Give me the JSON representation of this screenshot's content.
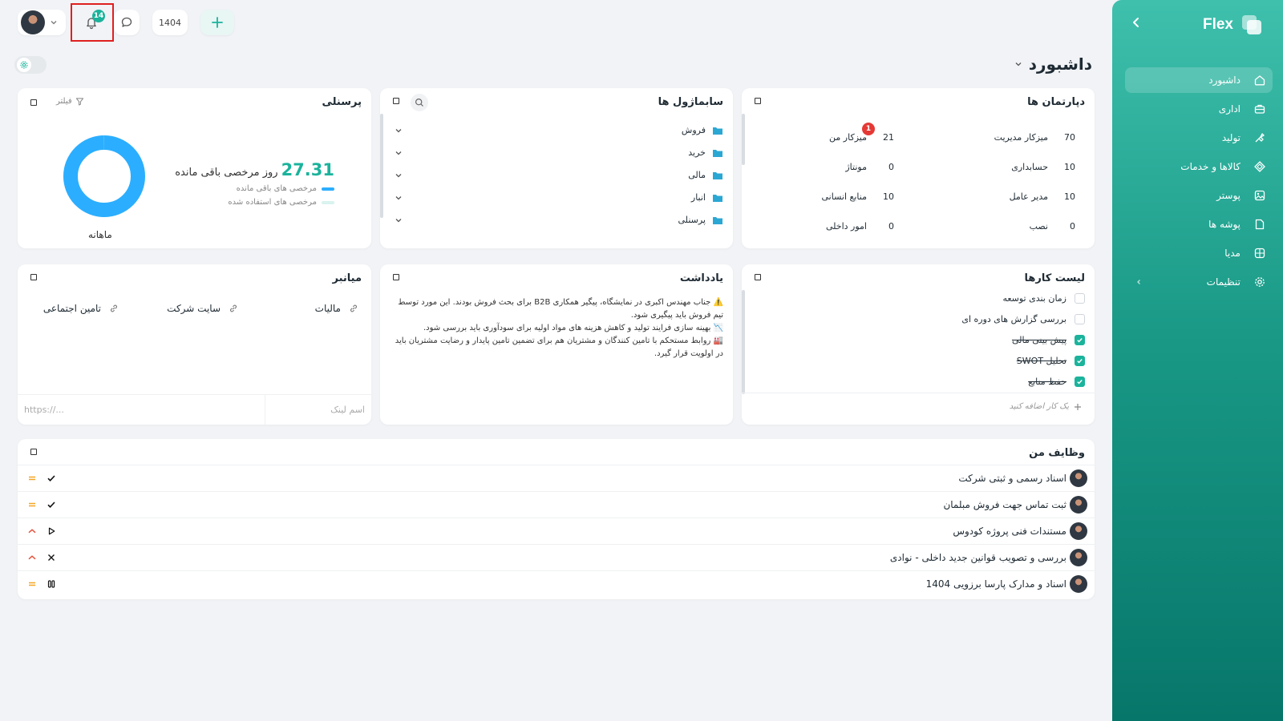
{
  "sidebar": {
    "brand": "Flex",
    "items": [
      {
        "label": "داشبورد",
        "icon": "home-icon"
      },
      {
        "label": "اداری",
        "icon": "briefcase-icon"
      },
      {
        "label": "تولید",
        "icon": "factory-icon"
      },
      {
        "label": "کالاها و خدمات",
        "icon": "box-icon"
      },
      {
        "label": "پوستر",
        "icon": "image-icon"
      },
      {
        "label": "پوشه ها",
        "icon": "folder-icon"
      },
      {
        "label": "مدیا",
        "icon": "globe-icon"
      },
      {
        "label": "تنظیمات",
        "icon": "gear-icon"
      }
    ]
  },
  "topbar": {
    "notification_count": "14",
    "year": "1404"
  },
  "page": {
    "title": "داشبورد"
  },
  "departments": {
    "title": "دپارتمان ها",
    "items": [
      {
        "label": "میزکار مدیریت",
        "count": "70"
      },
      {
        "label": "میزکار من",
        "count": "21",
        "badge": "1"
      },
      {
        "label": "حسابداری",
        "count": "10"
      },
      {
        "label": "مونتاژ",
        "count": "0"
      },
      {
        "label": "مدیر عامل",
        "count": "10"
      },
      {
        "label": "منابع انسانی",
        "count": "10"
      },
      {
        "label": "نصب",
        "count": "0"
      },
      {
        "label": "امور داخلی",
        "count": "0"
      }
    ]
  },
  "org": {
    "title": "سابماژول ها",
    "items": [
      "فروش",
      "خرید",
      "مالی",
      "انبار",
      "پرسنلی"
    ]
  },
  "personnel": {
    "title": "پرسنلی",
    "filter_label": "فیلتر",
    "value": "27.31",
    "value_label": "روز مرخصی باقی مانده",
    "legend_remaining": "مرخصی های باقی مانده",
    "legend_used": "مرخصی های استفاده شده",
    "period": "ماهانه",
    "remaining_fraction": 1.0,
    "colors": {
      "remaining": "#2baeff",
      "used": "#d9f3ef"
    }
  },
  "todo": {
    "title": "لیست کارها",
    "items": [
      {
        "label": "زمان بندی توسعه",
        "done": false
      },
      {
        "label": "بررسی گزارش های دوره ای",
        "done": false
      },
      {
        "label": "پیش بینی مالی",
        "done": true
      },
      {
        "label": "تحلیل SWOT",
        "done": true
      },
      {
        "label": "حفظ منابع",
        "done": true
      }
    ],
    "add_placeholder": "یک کار اضافه کنید"
  },
  "note": {
    "title": "یادداشت",
    "lines": [
      "⚠️ جناب مهندس اکبری در نمایشگاه، پیگیر همکاری B2B برای بحث فروش بودند. این مورد توسط تیم فروش باید پیگیری شود.",
      "📉 بهینه سازی فرایند تولید و کاهش هزینه های مواد اولیه برای سودآوری باید بررسی شود.",
      "🏭 روابط مستحکم با تامین کنندگان و مشتریان هم برای تضمین تامین پایدار و رضایت مشتریان باید در اولویت قرار گیرد."
    ]
  },
  "shortcuts": {
    "title": "میانبر",
    "links": [
      "مالیات",
      "سایت شرکت",
      "تامین اجتماعی"
    ],
    "name_placeholder": "اسم لینک",
    "url_placeholder": "https://..."
  },
  "tasks": {
    "title": "وظایف من",
    "items": [
      {
        "name": "اسناد رسمی و ثبتی شرکت",
        "status": "done",
        "priority": "medium"
      },
      {
        "name": "ثبت تماس جهت فروش مبلمان",
        "status": "done",
        "priority": "medium"
      },
      {
        "name": "مستندات فنی پروژه کودوس",
        "status": "in-progress",
        "priority": "high"
      },
      {
        "name": "بررسی و تصویب قوانین جدید داخلی - نوادی",
        "status": "cancelled",
        "priority": "high"
      },
      {
        "name": "اسناد و مدارک پارسا برزویی 1404",
        "status": "paused",
        "priority": "medium"
      }
    ]
  },
  "colors": {
    "accent": "#1bb39c",
    "badge_red": "#e53935",
    "priority_medium": "#f5a623",
    "priority_high": "#e5533d"
  }
}
